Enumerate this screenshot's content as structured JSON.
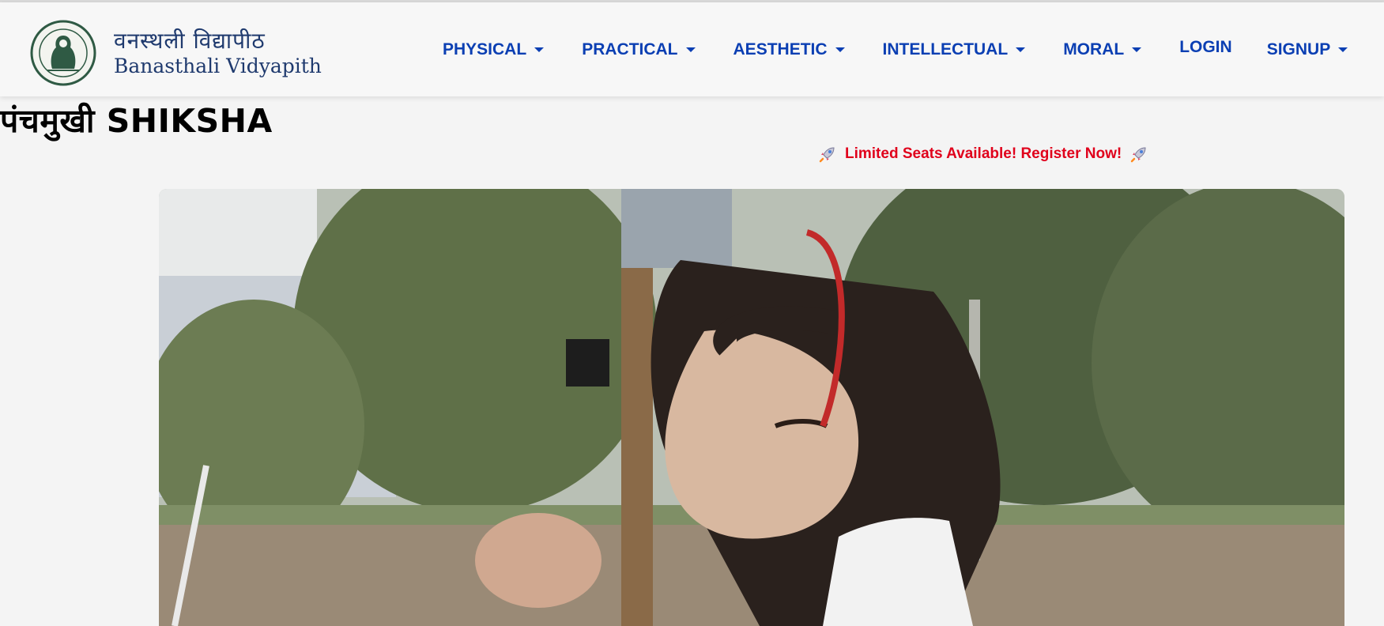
{
  "header": {
    "logo_caption_hindi": "वनस्थली विद्यापीठ",
    "logo_caption_english": "Banasthali Vidyapith",
    "nav": [
      {
        "label": "PHYSICAL",
        "dropdown": true
      },
      {
        "label": "PRACTICAL",
        "dropdown": true
      },
      {
        "label": "AESTHETIC",
        "dropdown": true
      },
      {
        "label": "INTELLECTUAL",
        "dropdown": true
      },
      {
        "label": "MORAL",
        "dropdown": true
      },
      {
        "label": "LOGIN",
        "dropdown": false
      },
      {
        "label": "SIGNUP",
        "dropdown": true
      }
    ]
  },
  "main": {
    "title": "पंचमुखी SHIKSHA",
    "banner": "Limited Seats Available! Register Now!",
    "banner_icon": "rocket-icon"
  },
  "colors": {
    "nav_text": "#0b3fb3",
    "banner_text": "#e0001b",
    "brand_text": "#1f3a6e"
  }
}
